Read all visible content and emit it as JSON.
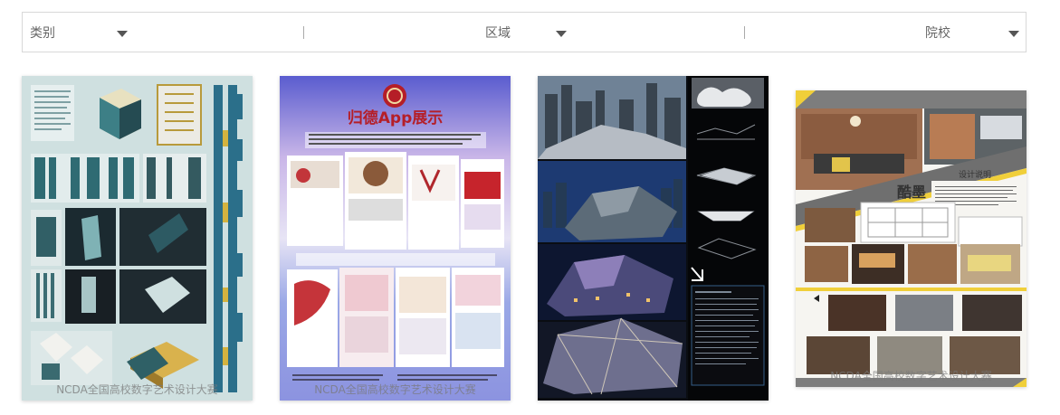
{
  "filters": {
    "category_label": "类别",
    "region_label": "区域",
    "school_label": "院校"
  },
  "cards": [
    {
      "watermark": "NCDA全国高校数字艺术设计大赛"
    },
    {
      "title": "归德App展示",
      "watermark": "NCDA全国高校数字艺术设计大赛"
    },
    {
      "watermark": ""
    },
    {
      "title": "酷墨",
      "subtitle": "设计说明",
      "watermark": "NCDA全国高校数字艺术设计大赛"
    }
  ],
  "colors": {
    "accent_yellow": "#f0cf3a",
    "card2_sky": "#9aa8e6",
    "card1_bg": "#cfe0e0"
  }
}
